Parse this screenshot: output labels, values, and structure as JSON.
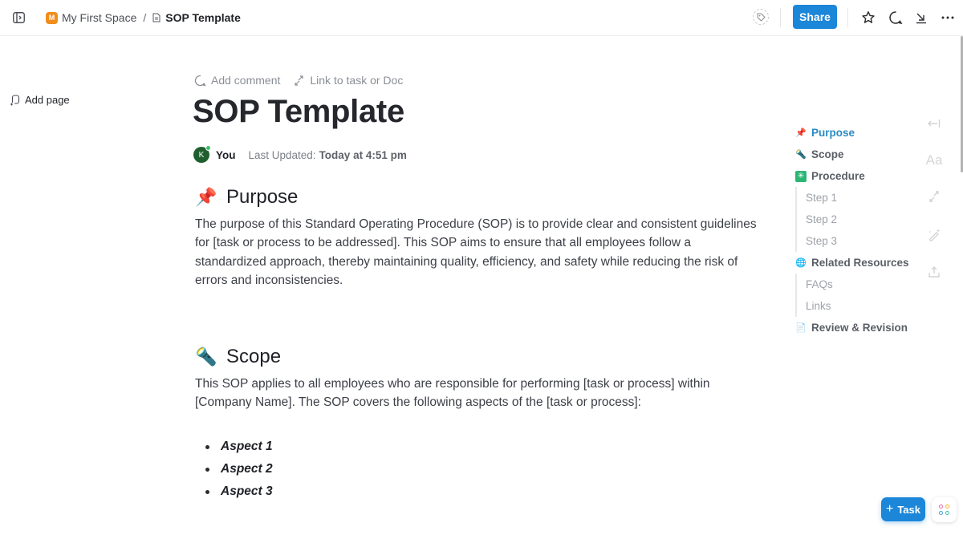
{
  "topbar": {
    "space_initial": "M",
    "space_name": "My First Space",
    "separator": "/",
    "doc_name": "SOP Template",
    "share_label": "Share"
  },
  "left": {
    "add_page_label": "Add page"
  },
  "doc": {
    "add_comment_label": "Add comment",
    "link_label": "Link to task or Doc",
    "title": "SOP Template",
    "author_initial": "K",
    "author": "You",
    "updated_label": "Last Updated:",
    "updated_value": "Today at 4:51 pm",
    "sections": [
      {
        "emoji": "📌",
        "heading": "Purpose",
        "body": "The purpose of this Standard Operating Procedure (SOP) is to provide clear and consistent guidelines for [task or process to be addressed]. This SOP aims to ensure that all employees follow a standardized approach, thereby maintaining quality, efficiency, and safety while reducing the risk of errors and inconsistencies."
      },
      {
        "emoji": "🔦",
        "heading": "Scope",
        "body": "This SOP applies to all employees who are responsible for performing [task or process] within [Company Name]. The SOP covers the following aspects of the [task or process]:",
        "bullets": [
          "Aspect 1",
          "Aspect 2",
          "Aspect 3"
        ]
      }
    ]
  },
  "toc": [
    {
      "icon": "📌",
      "label": "Purpose",
      "level": 1,
      "active": true
    },
    {
      "icon": "🔦",
      "label": "Scope",
      "level": 1,
      "active": false
    },
    {
      "icon": "✳",
      "label": "Procedure",
      "level": 1,
      "active": false
    },
    {
      "label": "Step 1",
      "level": 2
    },
    {
      "label": "Step 2",
      "level": 2
    },
    {
      "label": "Step 3",
      "level": 2
    },
    {
      "icon": "🌐",
      "label": "Related Resources",
      "level": 1,
      "active": false
    },
    {
      "label": "FAQs",
      "level": 2
    },
    {
      "label": "Links",
      "level": 2
    },
    {
      "icon": "📄",
      "label": "Review & Revision",
      "level": 1,
      "active": false
    }
  ],
  "rail": {
    "typography_label": "Aa"
  },
  "floating": {
    "task_plus": "+",
    "task_label": "Task"
  },
  "colors": {
    "accent": "#1c86d8",
    "toc_active": "#2a8bc4",
    "space_badge": "#f28c1a"
  }
}
